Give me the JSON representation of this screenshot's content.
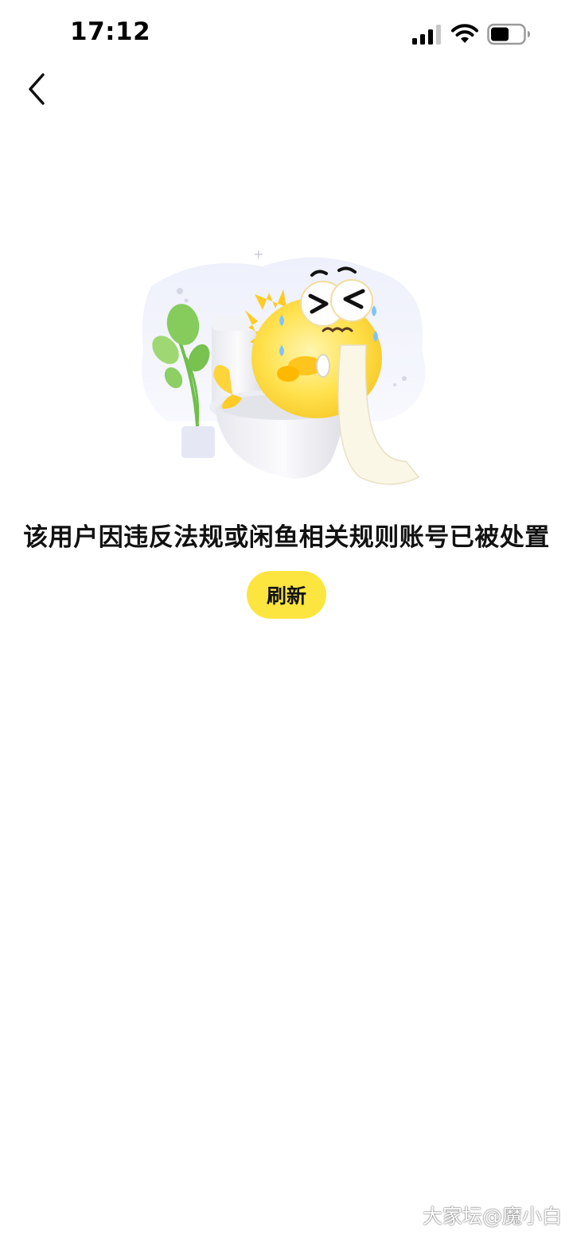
{
  "status_bar": {
    "time": "17:12",
    "signal_icon": "cellular-signal-icon",
    "wifi_icon": "wifi-icon",
    "battery_icon": "battery-icon",
    "battery_level": 0.55
  },
  "nav": {
    "back_icon": "chevron-left-icon"
  },
  "main": {
    "illustration": "crying-fish-on-toilet",
    "message": "该用户因违反法规或闲鱼相关规则账号已被处置",
    "refresh_label": "刷新"
  },
  "watermark": "大家坛@魔小白",
  "colors": {
    "accent": "#fde53f",
    "background": "#ffffff",
    "text": "#111111"
  }
}
